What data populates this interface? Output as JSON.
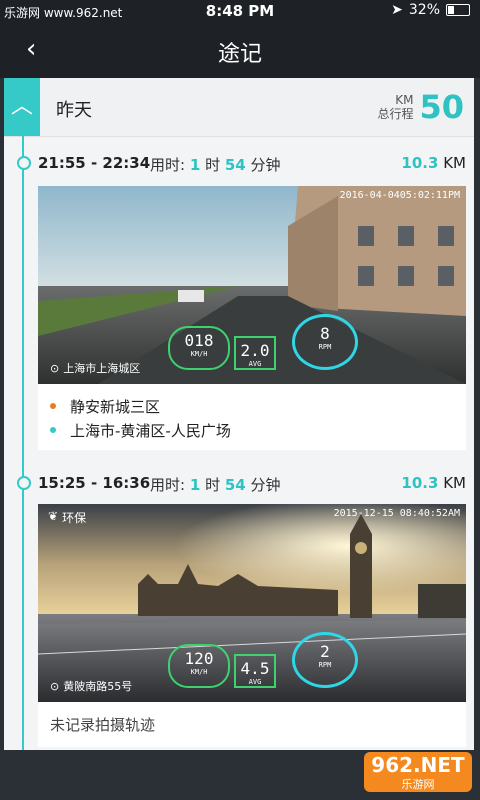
{
  "status": {
    "carrier": "乐游网 www.962.net",
    "time": "8:48 PM",
    "battery_pct_text": "32%",
    "battery_level": 0.32
  },
  "nav": {
    "back_icon": "chevron-left-icon",
    "title": "途记"
  },
  "day": {
    "label": "昨天",
    "total_unit": "KM",
    "total_label": "总行程",
    "total_value": "50"
  },
  "trips": [
    {
      "start": "21:55",
      "end": "22:34",
      "dur_label": "用时:",
      "hours": "1",
      "hours_unit": "时",
      "minutes": "54",
      "minutes_unit": "分钟",
      "distance": "10.3",
      "distance_unit": "KM",
      "photo": {
        "timestamp": "2016-04-0405:02:11PM",
        "location": "上海市上海城区",
        "speed": "018",
        "speed_unit": "KM/H",
        "avg": "2.0",
        "avg_unit": "AVG",
        "rpm": "8",
        "rpm_unit": "RPM"
      },
      "route": {
        "from": "静安新城三区",
        "to": "上海市-黄浦区-人民广场",
        "from_color": "#f07a1a",
        "to_color": "#35c9c7"
      }
    },
    {
      "start": "15:25",
      "end": "16:36",
      "dur_label": "用时:",
      "hours": "1",
      "hours_unit": "时",
      "minutes": "54",
      "minutes_unit": "分钟",
      "distance": "10.3",
      "distance_unit": "KM",
      "photo": {
        "tag": "环保",
        "timestamp": "2015-12-15   08:40:52AM",
        "location": "黄陂南路55号",
        "speed": "120",
        "speed_unit": "KM/H",
        "avg": "4.5",
        "avg_unit": "AVG",
        "rpm": "2",
        "rpm_unit": "RPM"
      },
      "note": "未记录拍摄轨迹"
    }
  ],
  "watermark": {
    "line1": "962.NET",
    "line2": "乐游网"
  },
  "colors": {
    "accent": "#35c9c7",
    "dark": "#1e2227"
  }
}
